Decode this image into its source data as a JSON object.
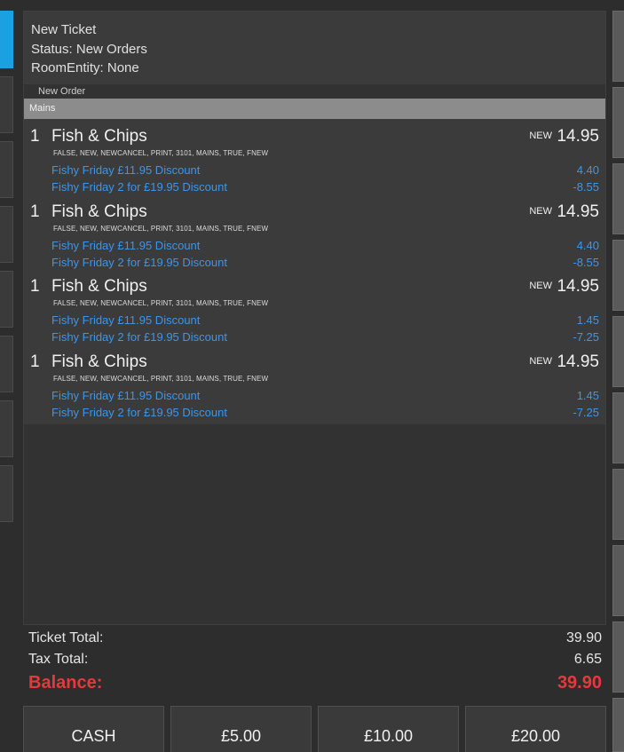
{
  "ticket": {
    "title": "New Ticket",
    "status": "Status: New Orders",
    "room_entity": "RoomEntity: None",
    "order_label": "New Order",
    "group": "Mains",
    "lines": [
      {
        "qty": "1",
        "name": "Fish & Chips",
        "state": "NEW",
        "price": "14.95",
        "tags": "FALSE, NEW, NEWCANCEL, PRINT, 3101, MAINS, TRUE, FNEW",
        "discounts": [
          {
            "label": "Fishy Friday £11.95 Discount",
            "value": "4.40"
          },
          {
            "label": "Fishy Friday 2 for £19.95 Discount",
            "value": "-8.55"
          }
        ]
      },
      {
        "qty": "1",
        "name": "Fish & Chips",
        "state": "NEW",
        "price": "14.95",
        "tags": "FALSE, NEW, NEWCANCEL, PRINT, 3101, MAINS, TRUE, FNEW",
        "discounts": [
          {
            "label": "Fishy Friday £11.95 Discount",
            "value": "4.40"
          },
          {
            "label": "Fishy Friday 2 for £19.95 Discount",
            "value": "-8.55"
          }
        ]
      },
      {
        "qty": "1",
        "name": "Fish & Chips",
        "state": "NEW",
        "price": "14.95",
        "tags": "FALSE, NEW, NEWCANCEL, PRINT, 3101, MAINS, TRUE, FNEW",
        "discounts": [
          {
            "label": "Fishy Friday £11.95 Discount",
            "value": "1.45"
          },
          {
            "label": "Fishy Friday 2 for £19.95 Discount",
            "value": "-7.25"
          }
        ]
      },
      {
        "qty": "1",
        "name": "Fish & Chips",
        "state": "NEW",
        "price": "14.95",
        "tags": "FALSE, NEW, NEWCANCEL, PRINT, 3101, MAINS, TRUE, FNEW",
        "discounts": [
          {
            "label": "Fishy Friday £11.95 Discount",
            "value": "1.45"
          },
          {
            "label": "Fishy Friday 2 for £19.95 Discount",
            "value": "-7.25"
          }
        ]
      }
    ]
  },
  "totals": {
    "ticket_total_label": "Ticket Total:",
    "ticket_total": "39.90",
    "tax_total_label": "Tax Total:",
    "tax_total": "6.65",
    "balance_label": "Balance:",
    "balance": "39.90"
  },
  "payment": {
    "cash": "CASH",
    "amount_1": "£5.00",
    "amount_2": "£10.00",
    "amount_3": "£20.00"
  },
  "colors": {
    "accent": "#1ba1e2",
    "discount": "#3d95e8",
    "balance": "#e8383b"
  }
}
